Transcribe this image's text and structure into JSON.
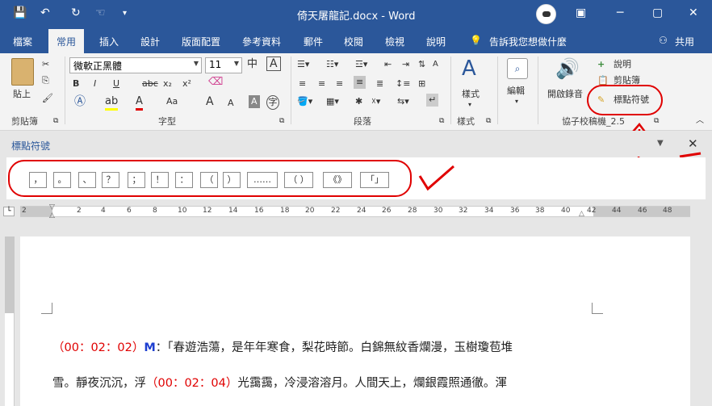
{
  "window": {
    "title": "倚天屠龍記.docx - Word",
    "controls": {
      "minimize": "─",
      "restore": "▢",
      "close": "✕",
      "ribbon_display": "▣"
    }
  },
  "quick_access": {
    "save": "💾",
    "undo": "↶",
    "redo": "↻",
    "touch": "☜",
    "customize": "▾"
  },
  "tabs": [
    "檔案",
    "常用",
    "插入",
    "設計",
    "版面配置",
    "參考資料",
    "郵件",
    "校閱",
    "檢視",
    "說明"
  ],
  "tell_me": "告訴我您想做什麼",
  "share": "共用",
  "ribbon": {
    "clipboard": {
      "paste": "貼上",
      "label": "剪貼簿"
    },
    "font": {
      "name": "微軟正黑體",
      "size": "11",
      "label": "字型",
      "bold": "B",
      "italic": "I",
      "underline": "U",
      "strike": "abc",
      "sub": "x₂",
      "sup": "x²",
      "case": "Aa",
      "grow": "A",
      "shrink": "A"
    },
    "paragraph": {
      "label": "段落"
    },
    "styles": {
      "button": "樣式",
      "label": "樣式"
    },
    "editing": {
      "button": "編輯"
    },
    "addin": {
      "record": "開啟錄音",
      "help": "說明",
      "clip": "剪貼簿",
      "punct": "標點符號",
      "label": "協子校稿機_2.5"
    }
  },
  "punct_panel": {
    "title": "標點符號",
    "buttons": [
      "，",
      "。",
      "、",
      "？",
      "；",
      "！",
      "：",
      "（",
      "）",
      "……",
      "（ ）",
      "《》",
      "「」"
    ]
  },
  "ruler": {
    "ticks": [
      "2",
      "2",
      "4",
      "6",
      "8",
      "10",
      "12",
      "14",
      "16",
      "18",
      "20",
      "22",
      "24",
      "26",
      "28",
      "30",
      "32",
      "34",
      "36",
      "38",
      "40",
      "42",
      "44",
      "46",
      "48"
    ]
  },
  "document": {
    "line1": {
      "ts": "（00：02：02）",
      "spk": "M",
      "text": "：「春遊浩蕩，是年年寒食，梨花時節。白錦無紋香爛漫，玉樹瓊苞堆"
    },
    "line2": {
      "pre": "雪。靜夜沉沉，浮",
      "ts": "（00：02：04）",
      "text": "光靄靄，冷浸溶溶月。人間天上，爛銀霞照通徹。渾"
    }
  },
  "colors": {
    "word_blue": "#2b579a",
    "timestamp_red": "#e00000",
    "speaker_blue": "#1e3fd0",
    "annotation_red": "#e00000"
  }
}
